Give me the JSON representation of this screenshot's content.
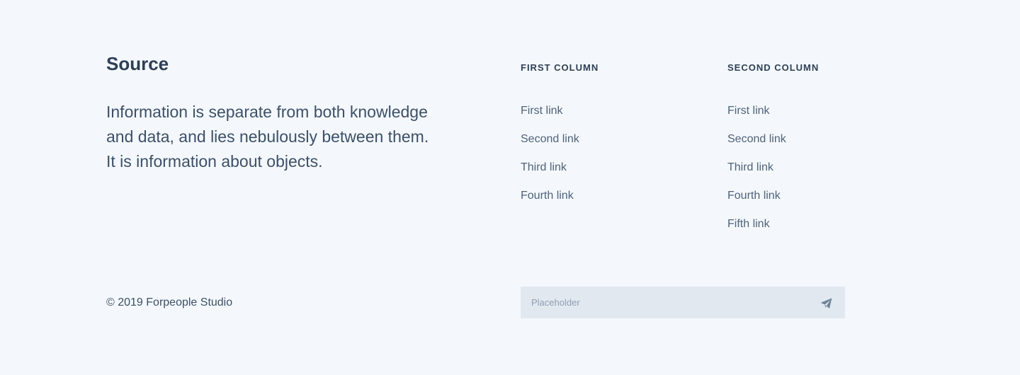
{
  "brand": {
    "title": "Source",
    "description": "Information is separate from both knowledge and data, and lies nebulously between them. It is information about objects."
  },
  "columns": [
    {
      "heading": "FIRST COLUMN",
      "links": [
        "First link",
        "Second link",
        "Third link",
        "Fourth link"
      ]
    },
    {
      "heading": "SECOND COLUMN",
      "links": [
        "First link",
        "Second link",
        "Third link",
        "Fourth link",
        "Fifth link"
      ]
    }
  ],
  "copyright": "© 2019 Forpeople Studio",
  "subscribe": {
    "placeholder": "Placeholder",
    "value": "",
    "send_icon": "send-icon"
  },
  "colors": {
    "background": "#f4f8fc",
    "text": "#304156",
    "input_background": "#e1e8f0",
    "icon": "#6f8499"
  }
}
